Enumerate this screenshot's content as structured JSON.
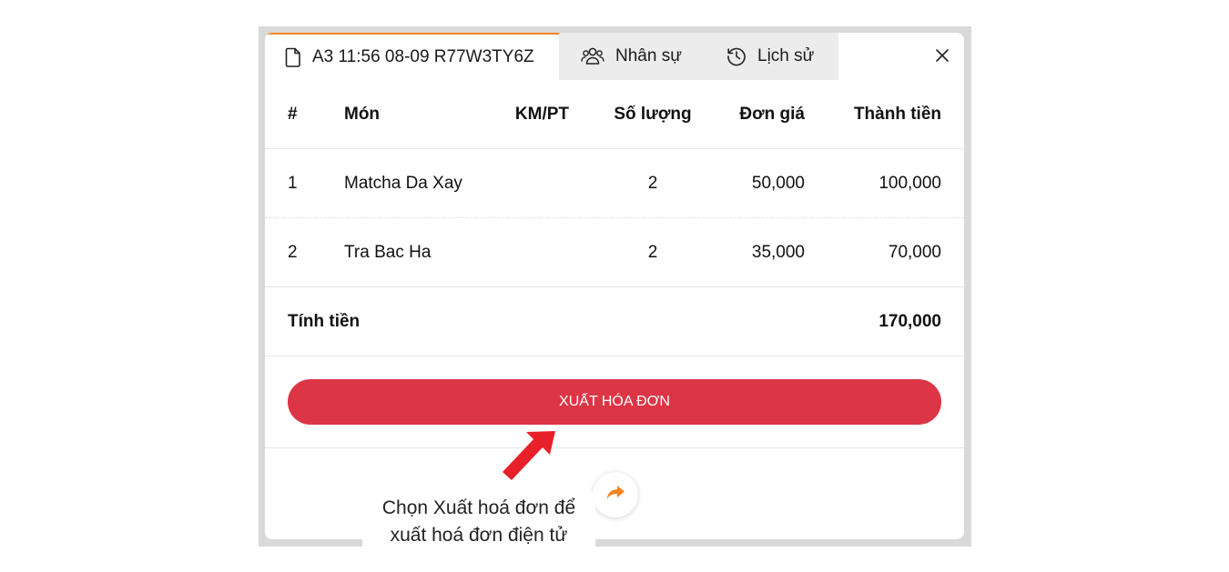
{
  "tabs": {
    "invoice": {
      "label": "A3 11:56 08-09 R77W3TY6Z",
      "icon": "document-icon"
    },
    "staff": {
      "label": "Nhân sự",
      "icon": "users-icon"
    },
    "history": {
      "label": "Lịch sử",
      "icon": "history-icon"
    }
  },
  "close_icon": "close-icon",
  "table": {
    "headers": {
      "num": "#",
      "name": "Món",
      "promo": "KM/PT",
      "qty": "Số lượng",
      "price": "Đơn giá",
      "amount": "Thành tiền"
    },
    "rows": [
      {
        "num": "1",
        "name": "Matcha Da Xay",
        "promo": "",
        "qty": "2",
        "price": "50,000",
        "amount": "100,000"
      },
      {
        "num": "2",
        "name": "Tra Bac Ha",
        "promo": "",
        "qty": "2",
        "price": "35,000",
        "amount": "70,000"
      }
    ]
  },
  "total": {
    "label": "Tính tiền",
    "value": "170,000"
  },
  "export_button": {
    "label": "XUẤT HÓA ĐƠN"
  },
  "share_icon": "share-arrow-icon",
  "caption": {
    "line1": "Chọn Xuất hoá đơn để",
    "line2": "xuất hoá đơn điện tử"
  },
  "colors": {
    "accent_tab": "#f5841f",
    "export_button": "#dc3545",
    "share_icon": "#f5841f",
    "annotation_arrow": "#e8202a"
  }
}
